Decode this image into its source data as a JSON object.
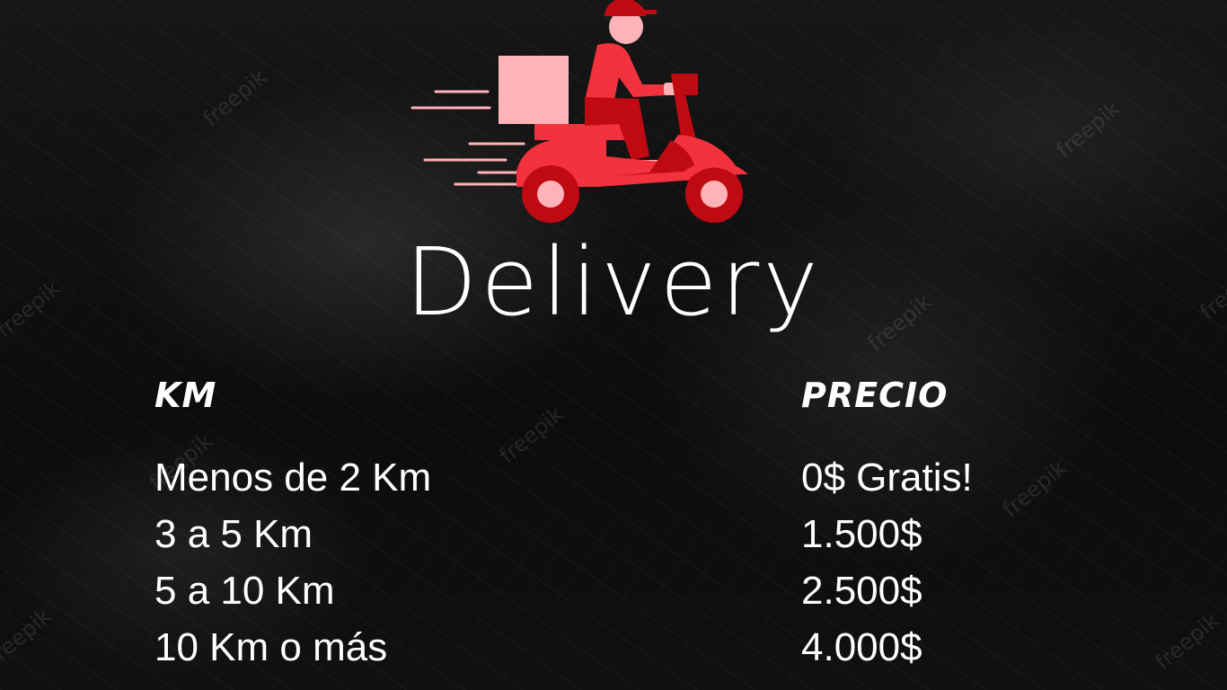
{
  "title": "Delivery",
  "logo": {
    "icon": "delivery-scooter-icon",
    "colors": {
      "dark_red": "#c00a12",
      "red": "#f2323c",
      "pink": "#ffb3b8"
    }
  },
  "table": {
    "headers": {
      "km": "KM",
      "price": "PRECIO"
    },
    "rows": [
      {
        "km": "Menos de 2 Km",
        "price": "0$ Gratis!"
      },
      {
        "km": "3 a 5 Km",
        "price": "1.500$"
      },
      {
        "km": "5 a 10 Km",
        "price": "2.500$"
      },
      {
        "km": "10 Km o más",
        "price": "4.000$"
      }
    ]
  },
  "watermark": "freepik",
  "colors": {
    "background": "#0b0b0b",
    "text": "#ffffff"
  }
}
